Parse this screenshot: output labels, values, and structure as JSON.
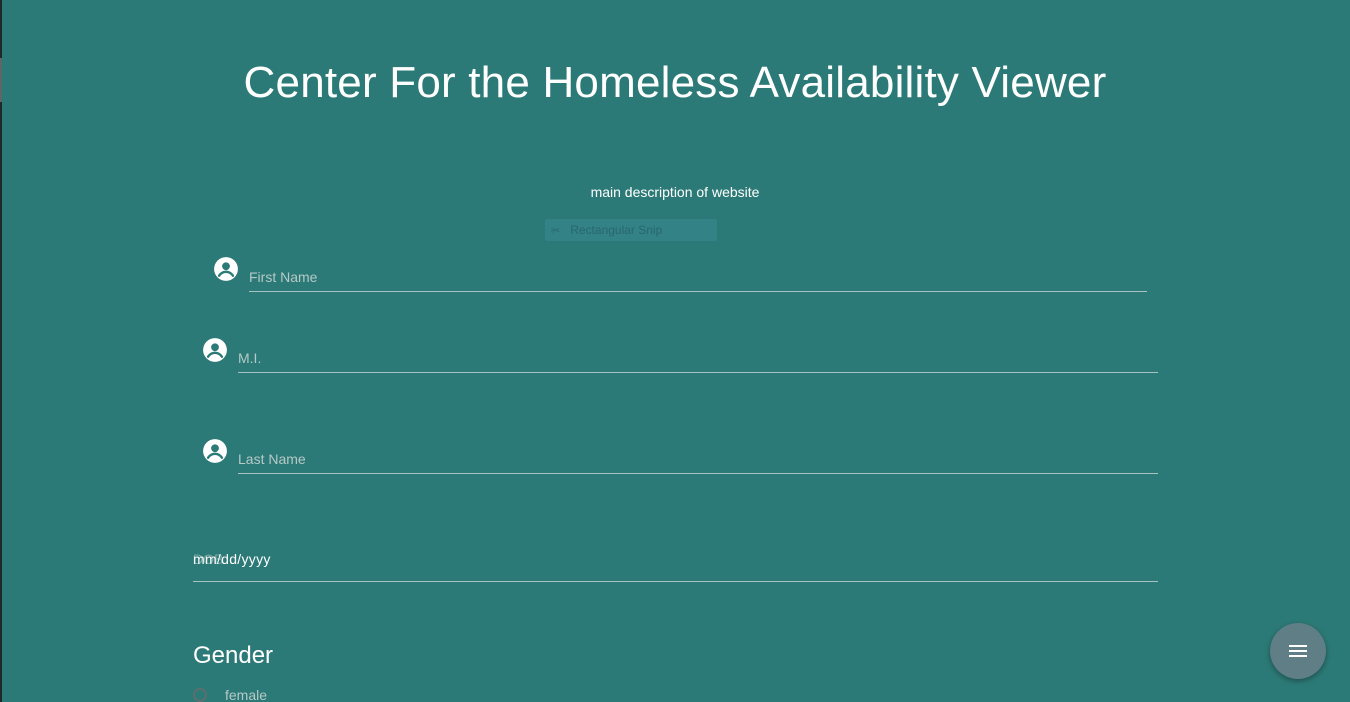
{
  "header": {
    "title": "Center For the Homeless Availability Viewer",
    "description": "main description of website"
  },
  "overlay_chip": {
    "label": "Rectangular Snip",
    "icon": "scissors-icon"
  },
  "form": {
    "first_name": {
      "placeholder": "First Name",
      "value": "",
      "icon": "account-circle-icon"
    },
    "middle_initial": {
      "placeholder": "M.I.",
      "value": "",
      "icon": "account-circle-icon"
    },
    "last_name": {
      "placeholder": "Last Name",
      "value": "",
      "icon": "account-circle-icon"
    },
    "dob": {
      "label": "DOB",
      "value": "mm/dd/yyyy"
    },
    "gender": {
      "heading": "Gender",
      "options": [
        {
          "label": "female",
          "selected": false
        }
      ]
    }
  },
  "fab": {
    "icon": "menu-icon"
  },
  "colors": {
    "background": "#2c7a77",
    "text": "#ffffff",
    "underline": "#a7c4c2",
    "fab": "#5f7e86"
  }
}
